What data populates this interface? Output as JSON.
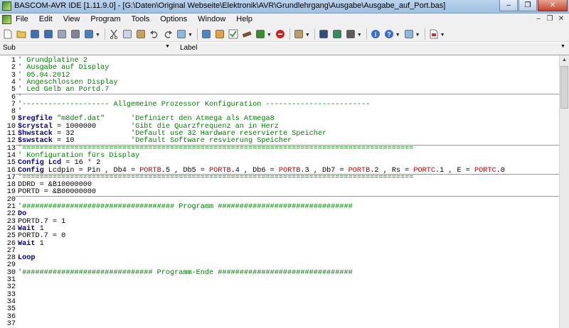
{
  "window": {
    "title": "BASCOM-AVR IDE [1.11.9.0] - [G:\\Daten\\Original Webseite\\Elektronik\\AVR\\Grundlehrgang\\Ausgabe\\Ausgabe_auf_Port.bas]",
    "min_label": "–",
    "max_label": "❐",
    "close_label": "✕"
  },
  "menu": {
    "items": [
      "File",
      "Edit",
      "View",
      "Program",
      "Tools",
      "Options",
      "Window",
      "Help"
    ],
    "mdi_min": "–",
    "mdi_restore": "❐",
    "mdi_close": "✕"
  },
  "toolbar": {
    "icons": [
      "new-file-icon",
      "open-folder-icon",
      "save-icon",
      "save-all-icon",
      "print-preview-icon",
      "print-icon",
      "window-icon",
      "cut-icon",
      "copy-icon",
      "paste-icon",
      "undo-icon",
      "redo-icon",
      "find-icon",
      "bookmark-icon",
      "compile-icon",
      "syntax-check-icon",
      "chip-program-icon",
      "chip-icon",
      "stop-icon",
      "simulate-icon",
      "terminal-icon",
      "lcd-designer-icon",
      "monitor-icon",
      "info-icon",
      "help-icon",
      "search-help-icon",
      "pdf-icon"
    ]
  },
  "combos": {
    "sub_label": "Sub",
    "label_label": "Label",
    "sub_value": "",
    "label_value": ""
  },
  "editor": {
    "lines": [
      {
        "n": "1",
        "t": "' Grundplatine 2"
      },
      {
        "n": "2",
        "t": "' Ausgabe auf Display"
      },
      {
        "n": "3",
        "t": "' 05.04.2012"
      },
      {
        "n": "4",
        "t": "' Angeschlossen Display"
      },
      {
        "n": "5",
        "t": "' Led Gelb an Portd.7"
      },
      {
        "n": "6",
        "t": "'"
      },
      {
        "n": "7",
        "t": "'-------------------- Allgemeine Prozessor Konfiguration ------------------------"
      },
      {
        "n": "8",
        "t": "'"
      },
      {
        "n": "9",
        "t": "$regfile \"m8def.dat\"      'Definiert den Atmega als Atmega8"
      },
      {
        "n": "10",
        "t": "$crystal = 1000000        'Gibt die Quarzfrequenz an in Herz"
      },
      {
        "n": "11",
        "t": "$hwstack = 32             'Default use 32 Hardware reservierte Speicher"
      },
      {
        "n": "12",
        "t": "$swstack = 10             'Default Software resvierung Speicher"
      },
      {
        "n": "13",
        "t": "'=========================================================================================="
      },
      {
        "n": "14",
        "t": "' Konfiguration fürs Display"
      },
      {
        "n": "15",
        "t": "Config Lcd = 16 * 2"
      },
      {
        "n": "16",
        "t": "Config Lcdpin = Pin , Db4 = PORTB.5 , Db5 = PORTB.4 , Db6 = PORTB.3 , Db7 = PORTB.2 , Rs = PORTC.1 , E = PORTC.0"
      },
      {
        "n": "17",
        "t": "'=========================================================================================="
      },
      {
        "n": "18",
        "t": "DDRD = &B10000000"
      },
      {
        "n": "19",
        "t": "PORTD = &B00000000"
      },
      {
        "n": "20",
        "t": ""
      },
      {
        "n": "21",
        "t": "'################################### Programm ###############################"
      },
      {
        "n": "22",
        "t": "Do"
      },
      {
        "n": "23",
        "t": "PORTD.7 = 1"
      },
      {
        "n": "24",
        "t": "Wait 1"
      },
      {
        "n": "25",
        "t": "PORTD.7 = 0"
      },
      {
        "n": "26",
        "t": "Wait 1"
      },
      {
        "n": "27",
        "t": ""
      },
      {
        "n": "28",
        "t": "Loop"
      },
      {
        "n": "29",
        "t": ""
      },
      {
        "n": "30",
        "t": "'############################## Programm-Ende ###############################"
      },
      {
        "n": "31",
        "t": ""
      },
      {
        "n": "32",
        "t": ""
      },
      {
        "n": "33",
        "t": ""
      },
      {
        "n": "34",
        "t": ""
      },
      {
        "n": "35",
        "t": ""
      },
      {
        "n": "36",
        "t": ""
      },
      {
        "n": "37",
        "t": ""
      }
    ]
  }
}
